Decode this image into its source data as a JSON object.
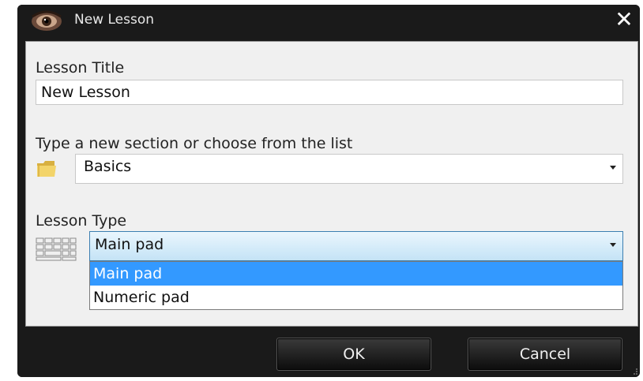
{
  "window": {
    "title": "New Lesson",
    "icon": "eye-app-icon",
    "close_icon": "close-icon"
  },
  "lesson_title": {
    "label": "Lesson Title",
    "value": "New Lesson"
  },
  "section": {
    "label": "Type a new section or choose from the list",
    "icon": "folder-icon",
    "value": "Basics"
  },
  "lesson_type": {
    "label": "Lesson Type",
    "icon": "keypad-icon",
    "value": "Main pad",
    "options": [
      "Main pad",
      "Numeric pad"
    ],
    "highlighted_option": "Main pad"
  },
  "buttons": {
    "ok": "OK",
    "cancel": "Cancel"
  },
  "colors": {
    "window_chrome": "#1a1a1a",
    "panel": "#f0f0f0",
    "selection": "#3399ff",
    "focus_border": "#3c7fb1"
  }
}
